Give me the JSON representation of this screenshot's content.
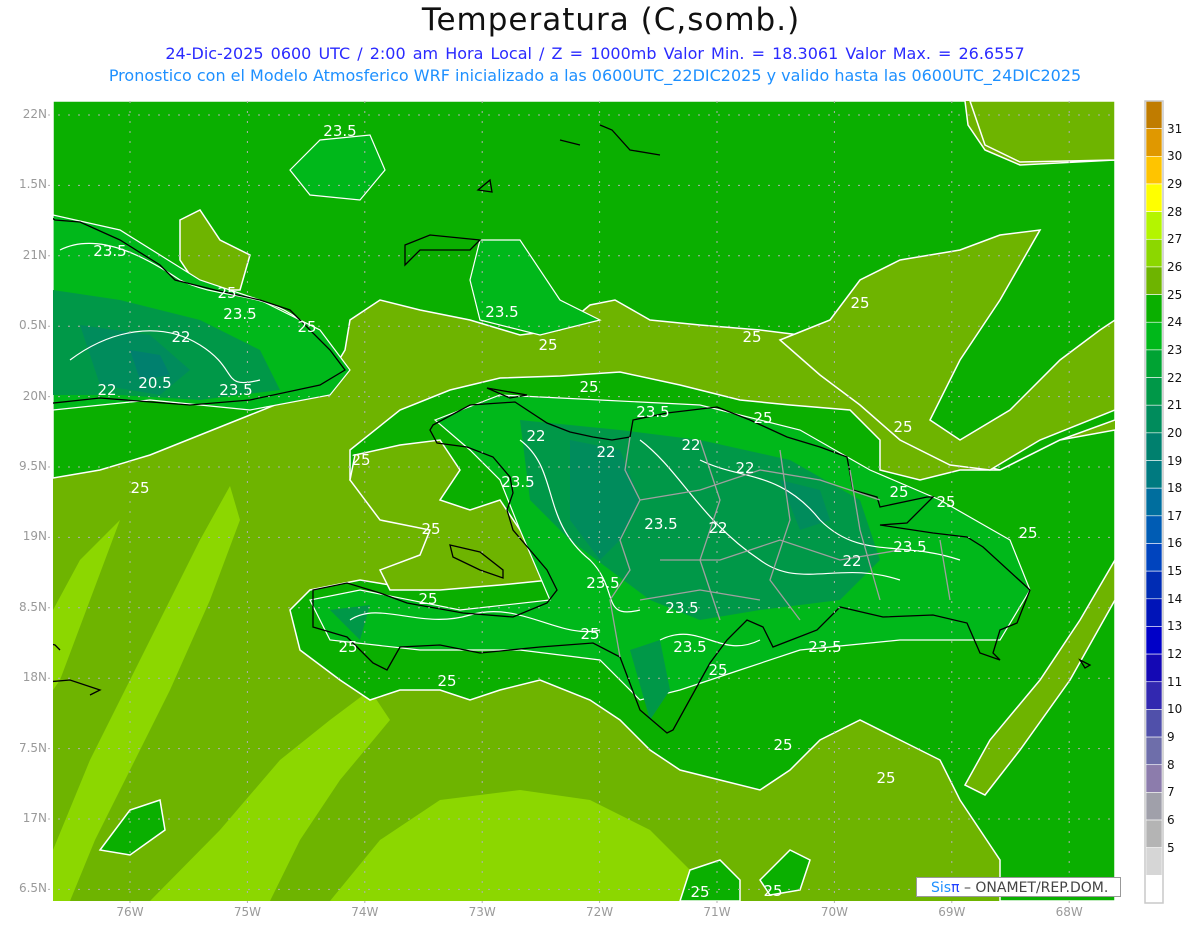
{
  "header": {
    "title": "Temperatura (C,somb.)",
    "line1": "24-Dic-2025  0600 UTC / 2:00 am Hora Local / Z = 1000mb   Valor Min. = 18.3061  Valor Max. = 26.6557",
    "line2": "Pronostico con el Modelo Atmosferico WRF inicializado a las 0600UTC_22DIC2025 y valido hasta las  0600UTC_24DIC2025"
  },
  "axes": {
    "lat_labels": [
      "22N",
      "1.5N",
      "21N",
      "0.5N",
      "20N",
      "9.5N",
      "19N",
      "8.5N",
      "18N",
      "7.5N",
      "17N",
      "6.5N"
    ],
    "lon_labels": [
      "76W",
      "75W",
      "74W",
      "73W",
      "72W",
      "71W",
      "70W",
      "69W",
      "68W"
    ]
  },
  "colorbar": {
    "labels": [
      "31",
      "30",
      "29",
      "28",
      "27",
      "26",
      "25",
      "24",
      "23",
      "22",
      "21",
      "20",
      "19",
      "18",
      "17",
      "16",
      "15",
      "14",
      "13",
      "12",
      "11",
      "10",
      "9",
      "8",
      "7",
      "6",
      "5"
    ],
    "colors": [
      "#c07c00",
      "#e09800",
      "#ffc400",
      "#ffff00",
      "#b4f500",
      "#8cd700",
      "#6eb400",
      "#0aaf00",
      "#00b81a",
      "#00a333",
      "#009848",
      "#008c5c",
      "#00806e",
      "#007a80",
      "#006e9e",
      "#005cb4",
      "#0044be",
      "#002cb4",
      "#0014b8",
      "#0000c8",
      "#1408b4",
      "#3228b0",
      "#5050aa",
      "#6e6eaa",
      "#8c7cac",
      "#a0a0aa",
      "#b4b4b4",
      "#d6d6d6",
      "#ffffff"
    ]
  },
  "contour_labels": [
    "23.5",
    "23.5",
    "25",
    "23.5",
    "25",
    "22",
    "20.5",
    "22",
    "23.5",
    "23.5",
    "25",
    "25",
    "25",
    "25",
    "23.5",
    "25",
    "25",
    "22",
    "22",
    "22",
    "22",
    "25",
    "23.5",
    "25",
    "25",
    "25",
    "25",
    "23.5",
    "22",
    "25",
    "23.5",
    "22",
    "23.5",
    "25",
    "23.5",
    "25",
    "25",
    "23.5",
    "23.5",
    "25",
    "25",
    "25",
    "25",
    "25",
    "25"
  ],
  "credit": {
    "sis": "Sis",
    "pi": "π",
    "rest": " –  ONAMET/REP.DOM."
  }
}
